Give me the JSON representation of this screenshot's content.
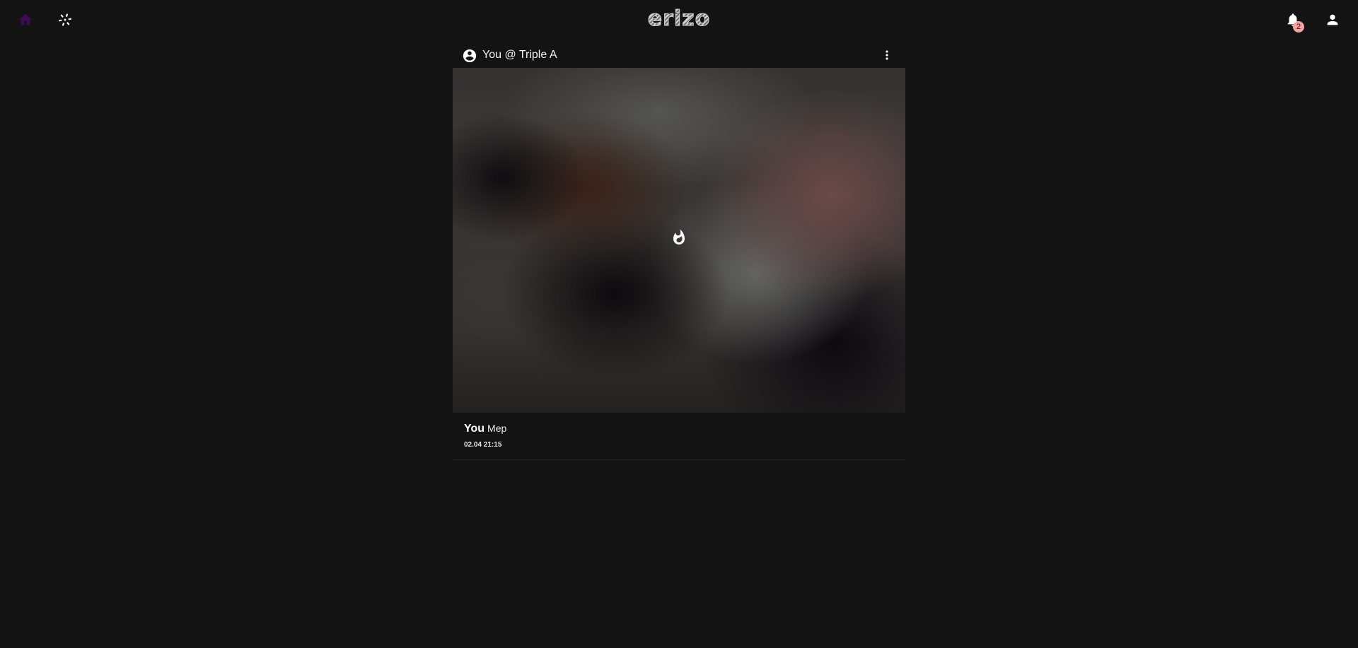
{
  "app": {
    "logo_text": "erizo",
    "accent_color": "#3d0a55",
    "badge_color": "#f4a3a3"
  },
  "nav": {
    "home_icon": "home-icon",
    "explore_icon": "sparkle-explore-icon",
    "notifications_icon": "bell-icon",
    "notifications_count": "2",
    "profile_icon": "person-icon"
  },
  "post": {
    "header_title": "You @ Triple A",
    "avatar_icon": "account-circle-icon",
    "menu_icon": "more-vertical-icon",
    "media_overlay_icon": "fire-icon",
    "author": "You",
    "caption": "Mep",
    "timestamp": "02.04 21:15"
  }
}
